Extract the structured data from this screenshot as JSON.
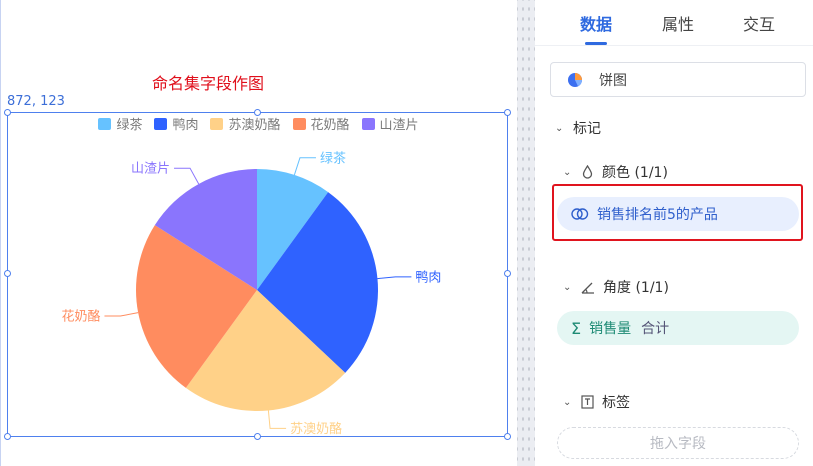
{
  "canvas": {
    "coord_readout": "872, 123"
  },
  "chart_data": {
    "type": "pie",
    "title": "命名集字段作图",
    "categories": [
      "绿茶",
      "鸭肉",
      "苏澳奶酪",
      "花奶酪",
      "山渣片"
    ],
    "values": [
      10,
      27,
      23,
      24,
      16
    ],
    "colors": [
      "#66c2ff",
      "#2f62ff",
      "#ffd188",
      "#ff8c5f",
      "#8a75fd"
    ],
    "legend": "top-center"
  },
  "panel": {
    "tabs": [
      {
        "label": "数据",
        "active": true
      },
      {
        "label": "属性",
        "active": false
      },
      {
        "label": "交互",
        "active": false
      }
    ],
    "chart_type": {
      "label": "饼图",
      "icon": "pie-chart-icon"
    },
    "marks_section": {
      "label": "标记"
    },
    "color_section": {
      "label": "颜色 (1/1)",
      "icon": "droplet-icon",
      "field": "销售排名前5的产品",
      "field_icon": "named-set-icon"
    },
    "angle_section": {
      "label": "角度 (1/1)",
      "icon": "angle-icon",
      "field": "销售量",
      "aggregation": "合计",
      "field_icon": "sigma-icon"
    },
    "label_section": {
      "label": "标签",
      "icon": "text-icon",
      "drop_placeholder": "拖入字段"
    }
  }
}
